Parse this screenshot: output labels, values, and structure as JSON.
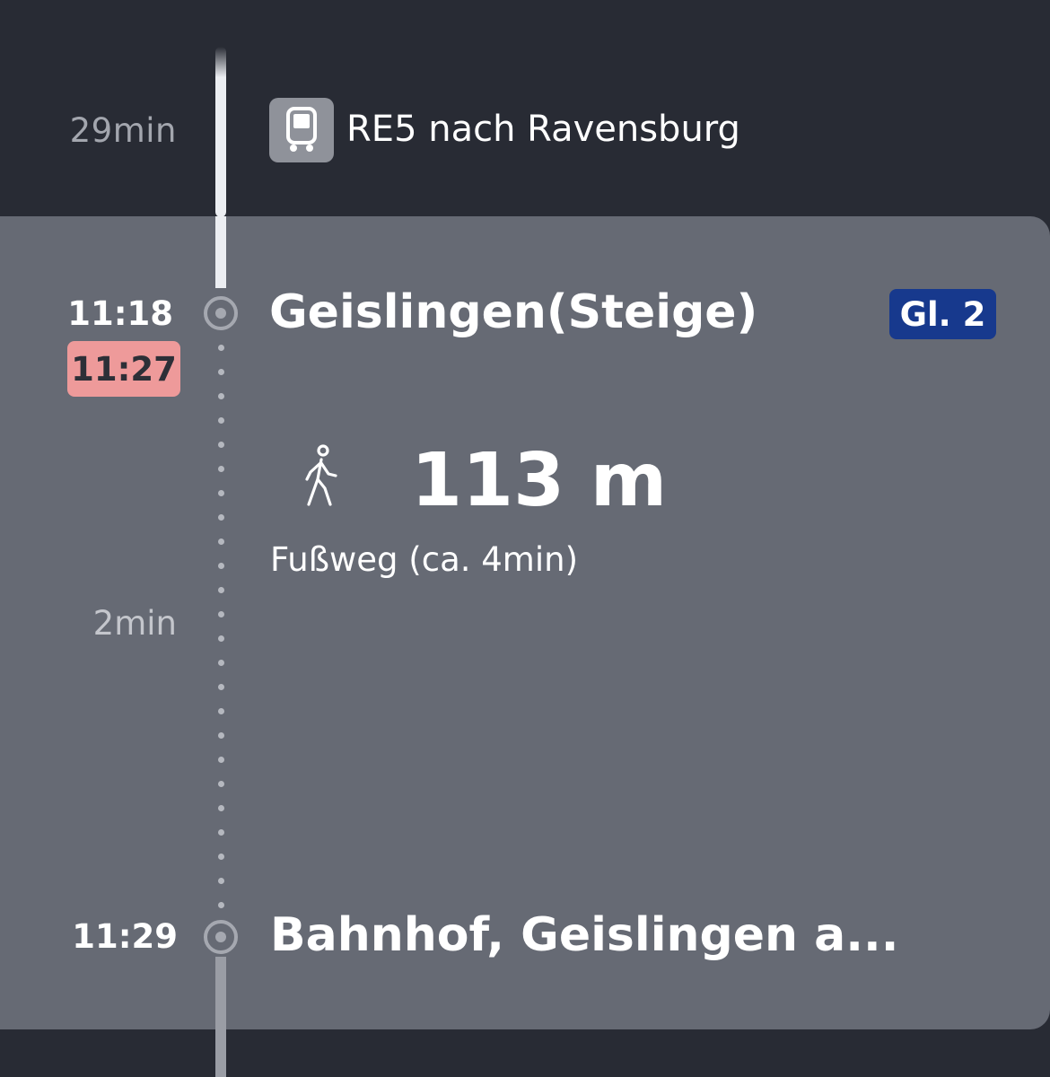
{
  "train_leg": {
    "duration": "29min",
    "icon": "train-icon",
    "label": "RE5 nach Ravensburg"
  },
  "departure_stop": {
    "scheduled_time": "11:18",
    "actual_time": "11:27",
    "name": "Geislingen(Steige)",
    "platform": "Gl. 2"
  },
  "walk_leg": {
    "icon": "walking-person-icon",
    "distance": "113 m",
    "description": "Fußweg (ca. 4min)",
    "duration": "2min"
  },
  "arrival_stop": {
    "time": "11:29",
    "name": "Bahnhof, Geislingen a..."
  },
  "colors": {
    "background": "#282b34",
    "card": "#666a74",
    "delay_badge": "#ee9a9a",
    "platform_badge": "#17398d"
  }
}
